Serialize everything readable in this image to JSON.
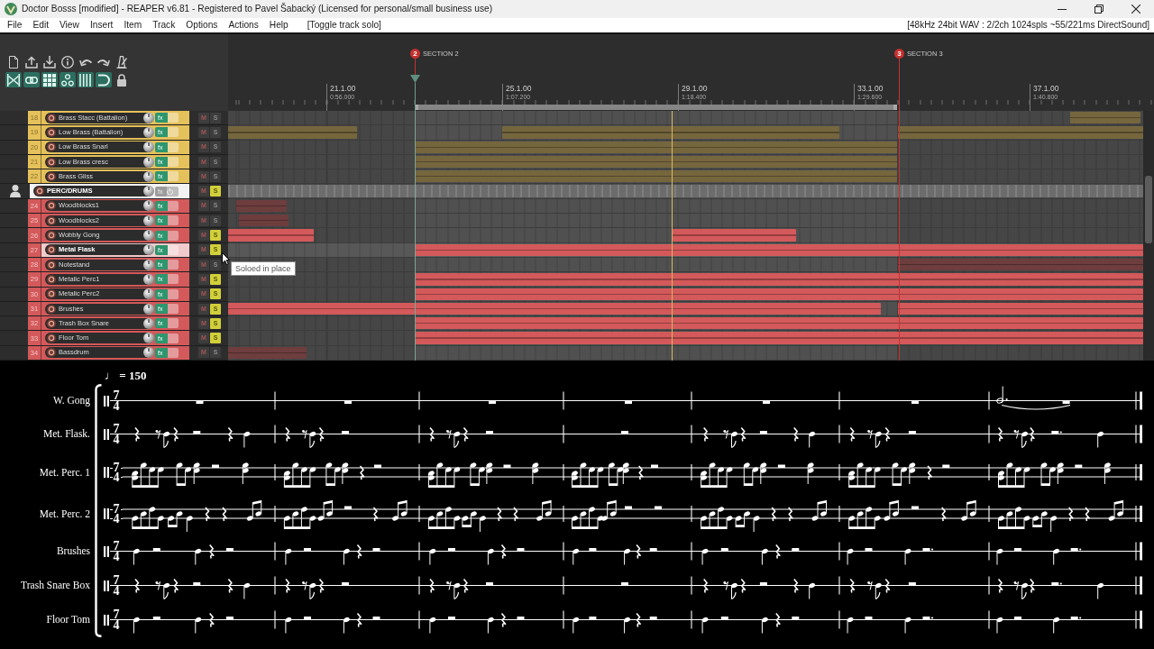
{
  "window": {
    "title": "Doctor Bosss [modified] - REAPER v6.81 - Registered to Pavel Šabacký (Licensed for personal/small business use)"
  },
  "menu": [
    "File",
    "Edit",
    "View",
    "Insert",
    "Item",
    "Track",
    "Options",
    "Actions",
    "Help"
  ],
  "last_action": "[Toggle track solo]",
  "audio_status": "[48kHz 24bit WAV : 2/2ch 1024spls ~55/221ms DirectSound]",
  "toolbar_toggles": [
    {
      "on": true
    },
    {
      "on": true
    },
    {
      "on": true
    },
    {
      "on": true
    },
    {
      "on": true
    },
    {
      "on": true
    },
    {
      "on": false
    }
  ],
  "markers": [
    {
      "number": "2",
      "label": "SECTION 2"
    },
    {
      "number": "3",
      "label": "SECTION 3"
    }
  ],
  "ruler": [
    {
      "bar": "21.1.00",
      "time": "0:56.000"
    },
    {
      "bar": "25.1.00",
      "time": "1:07.200"
    },
    {
      "bar": "29.1.00",
      "time": "1:18.400"
    },
    {
      "bar": "33.1.00",
      "time": "1:29.600"
    },
    {
      "bar": "37.1.00",
      "time": "1:40.800"
    }
  ],
  "tracks": [
    {
      "kind": "track",
      "number": "18",
      "name": "Brass Stacc (Battalion)",
      "color": "#e5c15b",
      "selected": false,
      "fx": {
        "label": "fx",
        "active": true
      },
      "mute": {
        "label": "M",
        "on": false
      },
      "solo": {
        "label": "S",
        "on": false
      }
    },
    {
      "kind": "track",
      "number": "19",
      "name": "Low Brass (Battalion)",
      "color": "#e5c15b",
      "selected": false,
      "fx": {
        "label": "fx",
        "active": true
      },
      "mute": {
        "label": "M",
        "on": false
      },
      "solo": {
        "label": "S",
        "on": false
      }
    },
    {
      "kind": "track",
      "number": "20",
      "name": "Low Brass Snarl",
      "color": "#e5c15b",
      "selected": false,
      "fx": {
        "label": "fx",
        "active": true
      },
      "mute": {
        "label": "M",
        "on": false
      },
      "solo": {
        "label": "S",
        "on": false
      }
    },
    {
      "kind": "track",
      "number": "21",
      "name": "Low Brass cresc",
      "color": "#e5c15b",
      "selected": false,
      "fx": {
        "label": "fx",
        "active": true
      },
      "mute": {
        "label": "M",
        "on": false
      },
      "solo": {
        "label": "S",
        "on": false
      }
    },
    {
      "kind": "track",
      "number": "22",
      "name": "Brass Gliss",
      "color": "#e5c15b",
      "selected": false,
      "fx": {
        "label": "fx",
        "active": true
      },
      "mute": {
        "label": "M",
        "on": false
      },
      "solo": {
        "label": "S",
        "on": false
      }
    },
    {
      "kind": "folder",
      "name": "PERC/DRUMS",
      "selected": true,
      "fx": {
        "label": "fx",
        "active": false
      },
      "mute": {
        "label": "M",
        "on": false
      },
      "solo": {
        "label": "S",
        "on": true
      },
      "children": [
        {
          "kind": "track",
          "number": "24",
          "name": "Woodblocks1",
          "color": "#d3595b",
          "selected": false,
          "fx": {
            "label": "fx",
            "active": true
          },
          "mute": {
            "label": "M",
            "on": false
          },
          "solo": {
            "label": "S",
            "on": false
          }
        },
        {
          "kind": "track",
          "number": "25",
          "name": "Woodblocks2",
          "color": "#d3595b",
          "selected": false,
          "fx": {
            "label": "fx",
            "active": true
          },
          "mute": {
            "label": "M",
            "on": false
          },
          "solo": {
            "label": "S",
            "on": false
          }
        },
        {
          "kind": "track",
          "number": "26",
          "name": "Wobbly Gong",
          "color": "#d3595b",
          "selected": false,
          "fx": {
            "label": "fx",
            "active": true
          },
          "mute": {
            "label": "M",
            "on": false
          },
          "solo": {
            "label": "S",
            "on": true
          }
        },
        {
          "kind": "track",
          "number": "27",
          "name": "Metal Flask",
          "color": "#d3595b",
          "selected": true,
          "fx": {
            "label": "fx",
            "active": true
          },
          "mute": {
            "label": "M",
            "on": false
          },
          "solo": {
            "label": "S",
            "on": true
          }
        },
        {
          "kind": "track",
          "number": "28",
          "name": "Notestand",
          "color": "#d3595b",
          "selected": false,
          "fx": {
            "label": "fx",
            "active": true
          },
          "mute": {
            "label": "M",
            "on": false
          },
          "solo": {
            "label": "S",
            "on": false
          }
        },
        {
          "kind": "track",
          "number": "29",
          "name": "Metalic Perc1",
          "color": "#d3595b",
          "selected": false,
          "fx": {
            "label": "fx",
            "active": true
          },
          "mute": {
            "label": "M",
            "on": false
          },
          "solo": {
            "label": "S",
            "on": true
          }
        },
        {
          "kind": "track",
          "number": "30",
          "name": "Metalic Perc2",
          "color": "#d3595b",
          "selected": false,
          "fx": {
            "label": "fx",
            "active": true
          },
          "mute": {
            "label": "M",
            "on": false
          },
          "solo": {
            "label": "S",
            "on": true
          }
        },
        {
          "kind": "track",
          "number": "31",
          "name": "Brushes",
          "color": "#d3595b",
          "selected": false,
          "fx": {
            "label": "fx",
            "active": true
          },
          "mute": {
            "label": "M",
            "on": false
          },
          "solo": {
            "label": "S",
            "on": true
          }
        },
        {
          "kind": "track",
          "number": "32",
          "name": "Trash Box Snare",
          "color": "#d3595b",
          "selected": false,
          "fx": {
            "label": "fx",
            "active": true
          },
          "mute": {
            "label": "M",
            "on": false
          },
          "solo": {
            "label": "S",
            "on": true
          }
        },
        {
          "kind": "track",
          "number": "33",
          "name": "Floor Tom",
          "color": "#d3595b",
          "selected": false,
          "fx": {
            "label": "fx",
            "active": true
          },
          "mute": {
            "label": "M",
            "on": false
          },
          "solo": {
            "label": "S",
            "on": true
          }
        },
        {
          "kind": "track",
          "number": "34",
          "name": "Bassdrum",
          "color": "#d3595b",
          "selected": false,
          "fx": {
            "label": "fx",
            "active": true
          },
          "mute": {
            "label": "M",
            "on": false
          },
          "solo": {
            "label": "S",
            "on": false
          }
        }
      ]
    }
  ],
  "tooltip": "Soloed in place",
  "score": {
    "tempo": "♩ = 150",
    "staves": [
      {
        "kind": "sustained",
        "name": "W. Gong",
        "time_signature": {
          "upper": "7",
          "lower": "4"
        }
      },
      {
        "kind": "offbeat",
        "name": "Met. Flask.",
        "time_signature": {
          "upper": "7",
          "lower": "4"
        }
      },
      {
        "kind": "beamed-chords",
        "name": "Met. Perc. 1",
        "time_signature": {
          "upper": "7",
          "lower": "4"
        }
      },
      {
        "kind": "beamed",
        "name": "Met. Perc. 2",
        "time_signature": {
          "upper": "7",
          "lower": "4"
        }
      },
      {
        "kind": "pulse",
        "name": "Brushes",
        "time_signature": {
          "upper": "7",
          "lower": "4"
        }
      },
      {
        "kind": "offbeat",
        "name": "Trash Snare Box",
        "time_signature": {
          "upper": "7",
          "lower": "4"
        }
      },
      {
        "kind": "pulse",
        "name": "Floor Tom",
        "time_signature": {
          "upper": "7",
          "lower": "4"
        }
      }
    ]
  }
}
